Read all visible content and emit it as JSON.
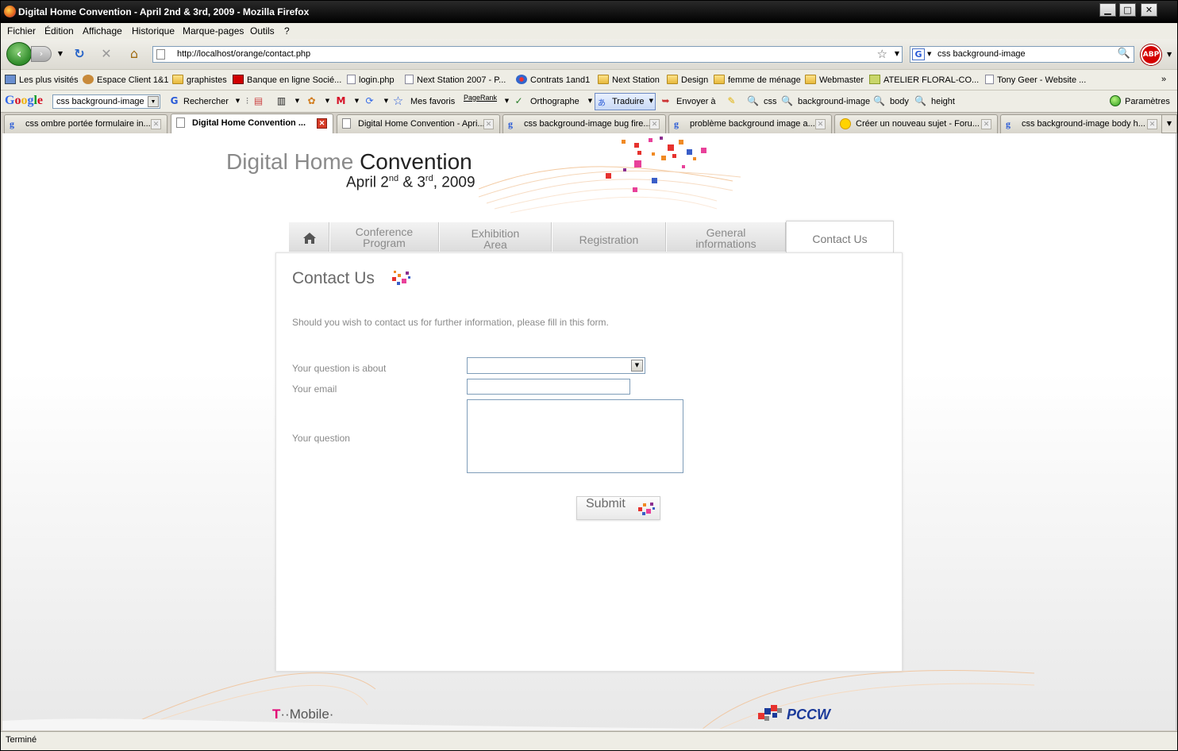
{
  "window": {
    "title": "Digital Home Convention - April 2nd & 3rd, 2009 - Mozilla Firefox",
    "buttons": {
      "minimize": "▁",
      "maximize": "□",
      "close": "✕"
    }
  },
  "menubar": [
    "Fichier",
    "Édition",
    "Affichage",
    "Historique",
    "Marque-pages",
    "Outils",
    "?"
  ],
  "navbar": {
    "url": "http://localhost/orange/contact.php",
    "search_value": "css background-image",
    "search_engine_letter": "G",
    "adblock_label": "ABP"
  },
  "bookmarks": [
    "Les plus visités",
    "Espace Client 1&1",
    "graphistes",
    "Banque en ligne Socié...",
    "login.php",
    "Next Station 2007 - P...",
    "Contrats 1and1",
    "Next Station",
    "Design",
    "femme de ménage",
    "Webmaster",
    "ATELIER FLORAL-CO...",
    "Tony Geer - Website ...",
    "»"
  ],
  "google_toolbar": {
    "logo": "Google",
    "query": "css background-image",
    "rechercher": "Rechercher",
    "mes_favoris": "Mes favoris",
    "pagerank": "PageRank",
    "orthographe": "Orthographe",
    "traduire": "Traduire",
    "envoyer": "Envoyer à",
    "terms": [
      "css",
      "background-image",
      "body",
      "height"
    ],
    "parametres": "Paramètres"
  },
  "tabs": [
    {
      "label": "css ombre portée formulaire in...",
      "active": false
    },
    {
      "label": "Digital Home Convention ...",
      "active": true
    },
    {
      "label": "Digital Home Convention - Apri...",
      "active": false
    },
    {
      "label": "css background-image bug fire...",
      "active": false
    },
    {
      "label": "problème background image a...",
      "active": false
    },
    {
      "label": "Créer un nouveau sujet - Foru...",
      "active": false
    },
    {
      "label": "css background-image body h...",
      "active": false
    }
  ],
  "site": {
    "title_light": "Digital Home",
    "title_dark": "Convention",
    "date_month": "April 2",
    "date_sup1": "nd",
    "date_amp": " & 3",
    "date_sup2": "rd",
    "date_year": ", 2009",
    "nav": [
      {
        "line1": "",
        "line2": "",
        "icon": "home-icon"
      },
      {
        "line1": "Conference",
        "line2": "Program"
      },
      {
        "line1": "Exhibition",
        "line2": "Area"
      },
      {
        "line1": "Registration",
        "line2": ""
      },
      {
        "line1": "General",
        "line2": "informations"
      },
      {
        "line1": "Contact Us",
        "line2": "",
        "active": true
      }
    ],
    "page_title": "Contact Us",
    "intro": "Should you wish to contact us for further information, please fill in this form.",
    "form": {
      "topic_label": "Your question is about",
      "topic_value": "",
      "email_label": "Your email",
      "email_value": "",
      "question_label": "Your question",
      "question_value": "",
      "submit_label": "Submit"
    },
    "sponsors": {
      "tmobile_t": "T",
      "tmobile_rest": "··Mobile·",
      "pccw": "PCCW"
    }
  },
  "status": "Terminé",
  "colors": {
    "accent_pink": "#e20074",
    "pccw_blue": "#1b3a9a",
    "confetti": [
      "#e6322e",
      "#f08a24",
      "#8c2f8f",
      "#3a5ec8",
      "#e8419a"
    ]
  }
}
